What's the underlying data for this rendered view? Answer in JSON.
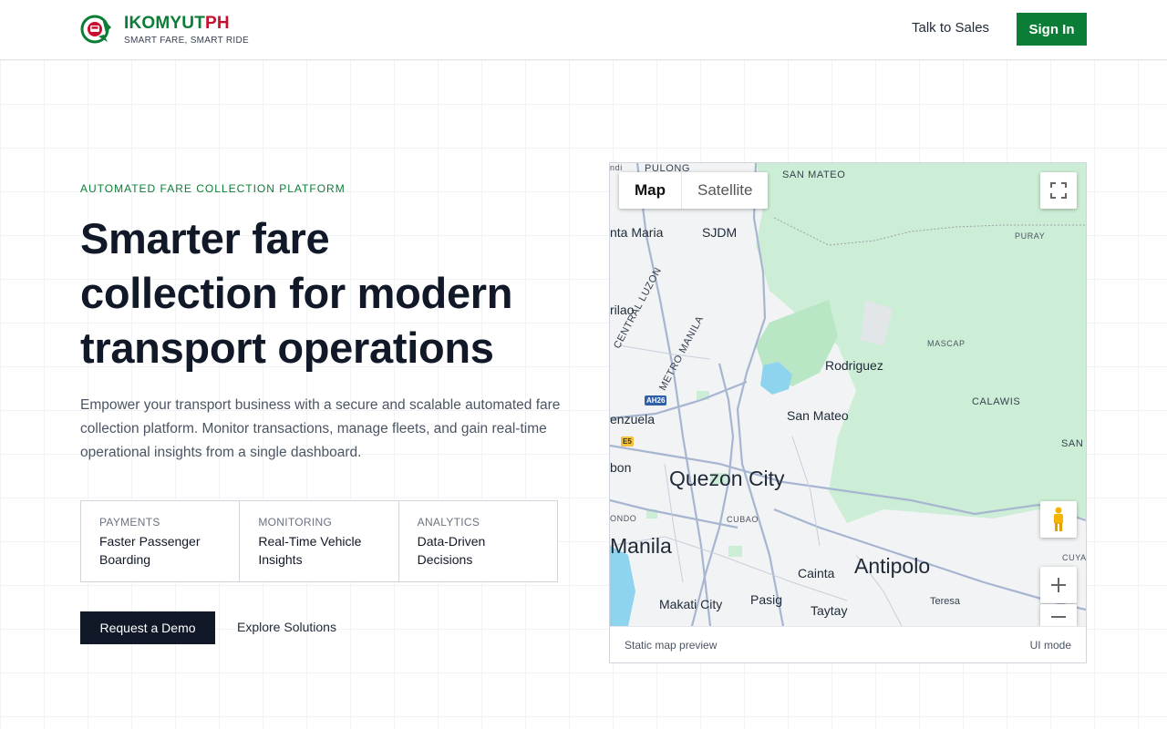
{
  "header": {
    "brand_primary": "IKOMYUT",
    "brand_secondary": "PH",
    "tagline": "SMART FARE, SMART RIDE",
    "talk_to_sales": "Talk to Sales",
    "sign_in": "Sign In"
  },
  "hero": {
    "eyebrow": "AUTOMATED FARE COLLECTION PLATFORM",
    "headline_line1": "Smarter fare",
    "headline_line2": "collection for modern",
    "headline_line3": "transport operations",
    "description": "Empower your transport business with a secure and scalable automated fare collection platform. Monitor transactions, manage fleets, and gain real-time operational insights from a single dashboard."
  },
  "features": [
    {
      "category": "PAYMENTS",
      "title": "Faster Passenger Boarding"
    },
    {
      "category": "MONITORING",
      "title": "Real-Time Vehicle Insights"
    },
    {
      "category": "ANALYTICS",
      "title": "Data-Driven Decisions"
    }
  ],
  "cta": {
    "request_demo": "Request a Demo",
    "explore_solutions": "Explore Solutions"
  },
  "map": {
    "type_options": [
      "Map",
      "Satellite"
    ],
    "selected_type": "Map",
    "labels": {
      "pulong": "PULONG",
      "san_mateo_top": "SAN MATEO",
      "santa_maria": "nta Maria",
      "sjdm": "SJDM",
      "puray": "PURAY",
      "central_luzon": "CENTRAL LUZON",
      "metro_manila": "METRO MANILA",
      "marilao": "rilao",
      "rodriguez": "Rodriguez",
      "mascap": "MASCAP",
      "calawis": "CALAWIS",
      "san_mateo": "San Mateo",
      "valenzuela": "enzuela",
      "san_right": "SAN",
      "malabon": "bon",
      "quezon_city": "Quezon City",
      "cubao": "CUBAO",
      "mondo": "ONDO",
      "manila": "Manila",
      "cainta": "Cainta",
      "antipolo": "Antipolo",
      "cuya": "CUYA",
      "makati": "Makati City",
      "pasig": "Pasig",
      "taytay": "Taytay",
      "teresa": "Teresa",
      "ndi": "ndi",
      "ah26": "AH26",
      "e5": "E5"
    },
    "footer_left": "Static map preview",
    "footer_right": "UI mode",
    "icons": [
      "fullscreen-icon",
      "pegman-icon",
      "zoom-in-icon",
      "zoom-out-icon"
    ]
  },
  "colors": {
    "brand_green": "#0b7d36",
    "brand_red": "#c8102e",
    "dark_button": "#111827",
    "map_park": "#cdeed6",
    "map_water": "#8fd4ee",
    "map_road": "#9aa9c8"
  }
}
